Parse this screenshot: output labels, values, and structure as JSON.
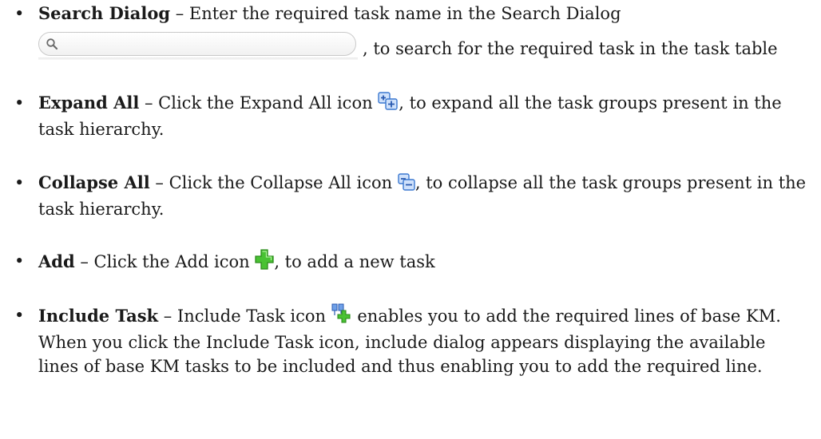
{
  "items": [
    {
      "term": "Search Dialog",
      "text_1": " – Enter the required task name in the Search Dialog",
      "text_2": ", to search for the required task in the task table",
      "icon": "search-field-icon"
    },
    {
      "term": "Expand All",
      "text_1": " – Click the Expand All icon ",
      "text_2": ", to expand all the task groups present in the task hierarchy.",
      "icon": "expand-all-icon"
    },
    {
      "term": "Collapse All",
      "text_1": " – Click the Collapse All icon ",
      "text_2": ", to collapse all the task groups present in the task hierarchy.",
      "icon": "collapse-all-icon"
    },
    {
      "term": "Add",
      "text_1": " – Click the Add icon ",
      "text_2": ", to add a new task",
      "icon": "add-icon"
    },
    {
      "term": "Include Task",
      "text_1": " – Include Task icon ",
      "text_2": " enables you to add the required lines of base KM. When you click the Include Task icon, include dialog appears displaying the available lines of base KM tasks to be included and thus enabling you to add the required line.",
      "icon": "include-task-icon"
    }
  ],
  "bullet_symbol": "•",
  "colors": {
    "text": "#1a1a1a",
    "icon_blue": "#3b78d0",
    "icon_green": "#3fb52a"
  }
}
